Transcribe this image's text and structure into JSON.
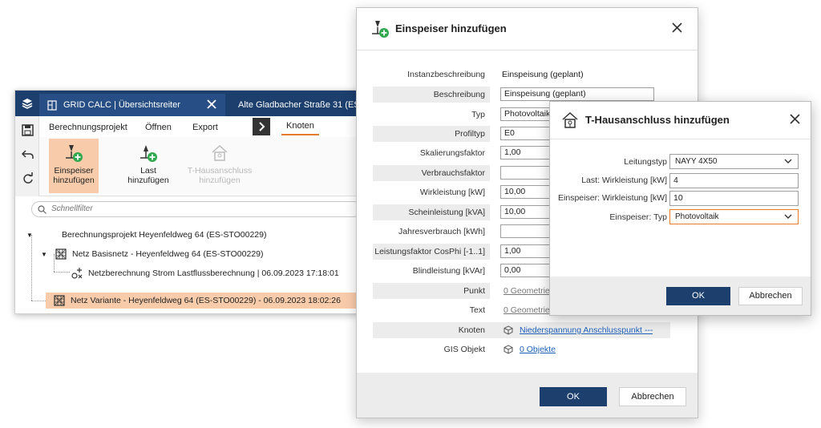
{
  "app": {
    "tabs": [
      {
        "label": "GRID CALC | Übersichtsreiter"
      },
      {
        "label": "Alte Gladbacher Straße 31 (ES-..."
      }
    ],
    "menu": {
      "items": [
        "Berechnungsprojekt",
        "Öffnen",
        "Export"
      ],
      "active": "Knoten"
    },
    "ribbon": {
      "buttons": [
        {
          "label_line1": "Einspeiser",
          "label_line2": "hinzufügen"
        },
        {
          "label_line1": "Last",
          "label_line2": "hinzufügen"
        },
        {
          "label_line1": "T-Hausanschluss",
          "label_line2": "hinzufügen"
        }
      ]
    },
    "filter_placeholder": "Schnellfilter",
    "tree": [
      {
        "label": "Berechnungsprojekt Heyenfeldweg 64 (ES-STO00229)"
      },
      {
        "label": "Netz Basisnetz - Heyenfeldweg 64 (ES-STO00229)"
      },
      {
        "label": "Netzberechnung Strom Lastflussberechnung | 06.09.2023 17:18:01"
      },
      {
        "label": "Netz Variante - Heyenfeldweg 64 (ES-STO00229) - 06.09.2023 18:02:26"
      }
    ]
  },
  "dialog_einspeiser": {
    "title": "Einspeiser hinzufügen",
    "rows": [
      {
        "label": "Instanzbeschreibung",
        "value": "Einspeisung (geplant)"
      },
      {
        "label": "Beschreibung",
        "value": "Einspeisung (geplant)"
      },
      {
        "label": "Typ",
        "value": "Photovoltaik"
      },
      {
        "label": "Profiltyp",
        "value": "E0"
      },
      {
        "label": "Skalierungsfaktor",
        "value": "1,00"
      },
      {
        "label": "Verbrauchsfaktor",
        "value": ""
      },
      {
        "label": "Wirkleistung [kW]",
        "value": "10,00"
      },
      {
        "label": "Scheinleistung [kVA]",
        "value": "10,00"
      },
      {
        "label": "Jahresverbrauch [kWh]",
        "value": ""
      },
      {
        "label": "Leistungsfaktor CosPhi [-1..1]",
        "value": "1,00"
      },
      {
        "label": "Blindleistung [kVAr]",
        "value": "0,00"
      },
      {
        "label": "Punkt",
        "value": "0 Geometrien"
      },
      {
        "label": "Text",
        "value": "0 Geometrien"
      },
      {
        "label": "Knoten",
        "value": "Niederspannung Anschlusspunkt ---"
      },
      {
        "label": "GIS Objekt",
        "value": "0 Objekte"
      }
    ],
    "ok_label": "OK",
    "cancel_label": "Abbrechen"
  },
  "dialog_hausanschluss": {
    "title": "T-Hausanschluss hinzufügen",
    "rows": [
      {
        "label": "Leitungstyp",
        "value": "NAYY 4X50"
      },
      {
        "label": "Last: Wirkleistung [kW]",
        "value": "4"
      },
      {
        "label": "Einspeiser: Wirkleistung [kW]",
        "value": "10"
      },
      {
        "label": "Einspeiser: Typ",
        "value": "Photovoltaik"
      }
    ],
    "ok_label": "OK",
    "cancel_label": "Abbrechen"
  },
  "colors": {
    "titlebar": "#1c3f6e",
    "accent": "#e47b2f",
    "selection": "#f8ccaa",
    "link": "#1f5fb8",
    "add_green": "#2fa84f"
  }
}
